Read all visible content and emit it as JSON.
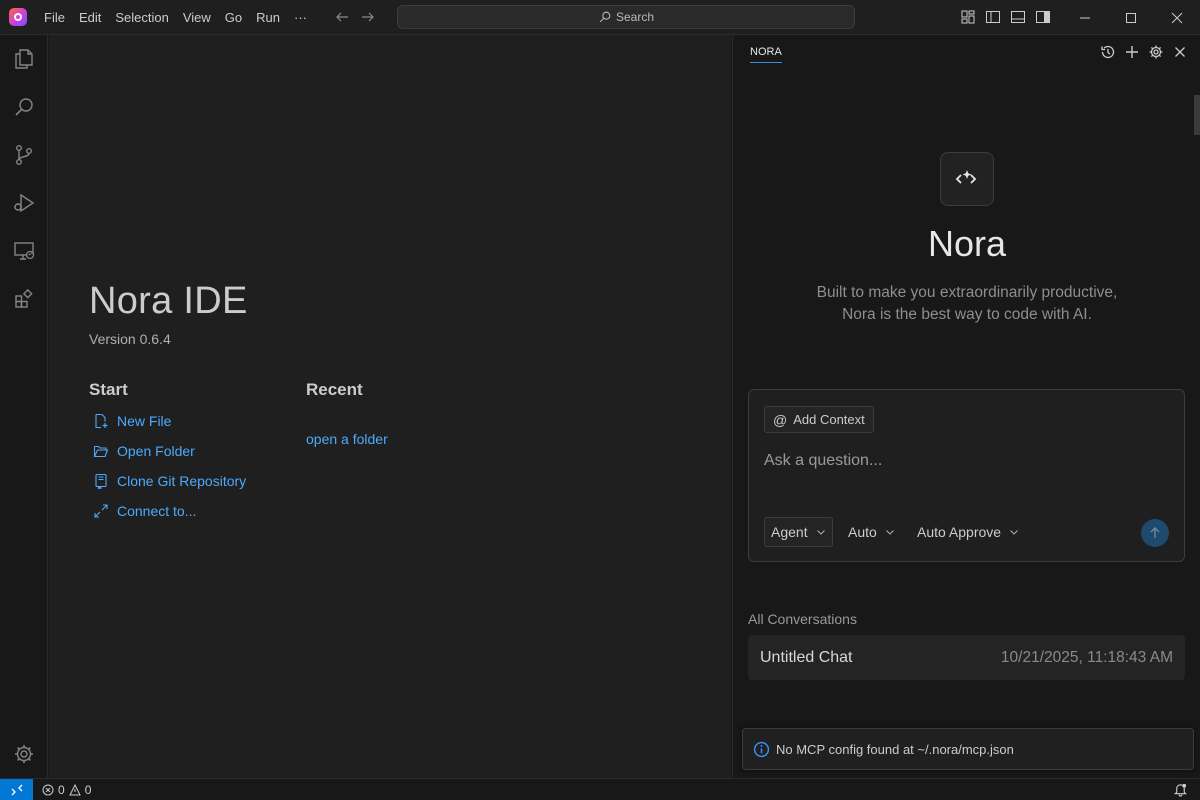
{
  "menu": [
    "File",
    "Edit",
    "Selection",
    "View",
    "Go",
    "Run",
    "···"
  ],
  "search": {
    "label": "Search"
  },
  "activitybar": {
    "icons": [
      "explorer-icon",
      "search-icon",
      "source-control-icon",
      "run-debug-icon",
      "remote-explorer-icon",
      "extensions-icon",
      "settings-gear-icon"
    ]
  },
  "welcome": {
    "title": "Nora IDE",
    "version": "Version 0.6.4",
    "start_heading": "Start",
    "recent_heading": "Recent",
    "start_items": [
      {
        "label": "New File",
        "icon": "new-file-icon"
      },
      {
        "label": "Open Folder",
        "icon": "folder-open-icon"
      },
      {
        "label": "Clone Git Repository",
        "icon": "repo-clone-icon"
      },
      {
        "label": "Connect to...",
        "icon": "remote-connect-icon"
      }
    ],
    "recent_link": "open a folder"
  },
  "panel": {
    "tab": "NORA",
    "title": "Nora",
    "tagline_line1": "Built to make you extraordinarily productive,",
    "tagline_line2": "Nora is the best way to code with AI.",
    "add_context": "Add Context",
    "add_context_symbol": "@",
    "ask_placeholder": "Ask a question...",
    "mode": "Agent",
    "model": "Auto",
    "approve": "Auto Approve",
    "conversations_heading": "All Conversations",
    "conversations": [
      {
        "title": "Untitled Chat",
        "time": "10/21/2025, 11:18:43 AM"
      }
    ],
    "mcp_notice": "No MCP config found at ~/.nora/mcp.json"
  },
  "status": {
    "errors": "0",
    "warnings": "0"
  },
  "colors": {
    "accent": "#0078d4",
    "link": "#4daafc",
    "background": "#1f1f1f"
  }
}
